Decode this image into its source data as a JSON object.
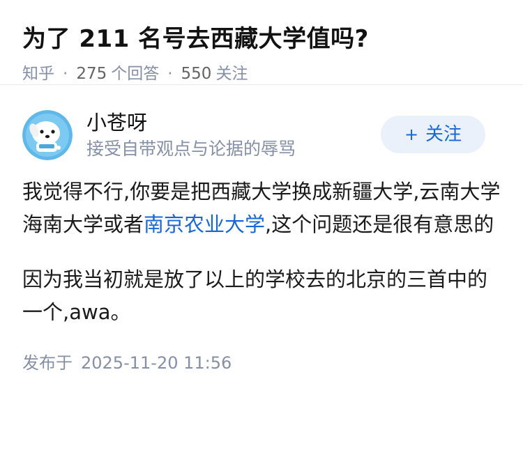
{
  "question": {
    "title": "为了 211 名号去西藏大学值吗?",
    "source": "知乎",
    "answer_count": "275",
    "answer_label": "个回答",
    "follower_count": "550",
    "follower_label": "关注",
    "separator": "·"
  },
  "author": {
    "name": "小苍呀",
    "bio": "接受自带观点与论据的辱骂",
    "avatar_icon": "dog-avatar-icon",
    "follow_plus": "+",
    "follow_label": "关注"
  },
  "answer": {
    "paragraph1_text1": "我觉得不行,你要是把西藏大学换成新疆大学,云南大学 海南大学或者",
    "paragraph1_link": "南京农业大学",
    "paragraph1_text2": ",这个问题还是很有意思的",
    "paragraph2": "因为我当初就是放了以上的学校去的北京的三首中的一个,awa。"
  },
  "publish": {
    "label": "发布于",
    "time": "2025-11-20 11:56"
  },
  "colors": {
    "link": "#1667d9",
    "meta": "#8590a6",
    "follow_bg": "#eaf1fb",
    "avatar_bg": "#5fb8ea"
  }
}
